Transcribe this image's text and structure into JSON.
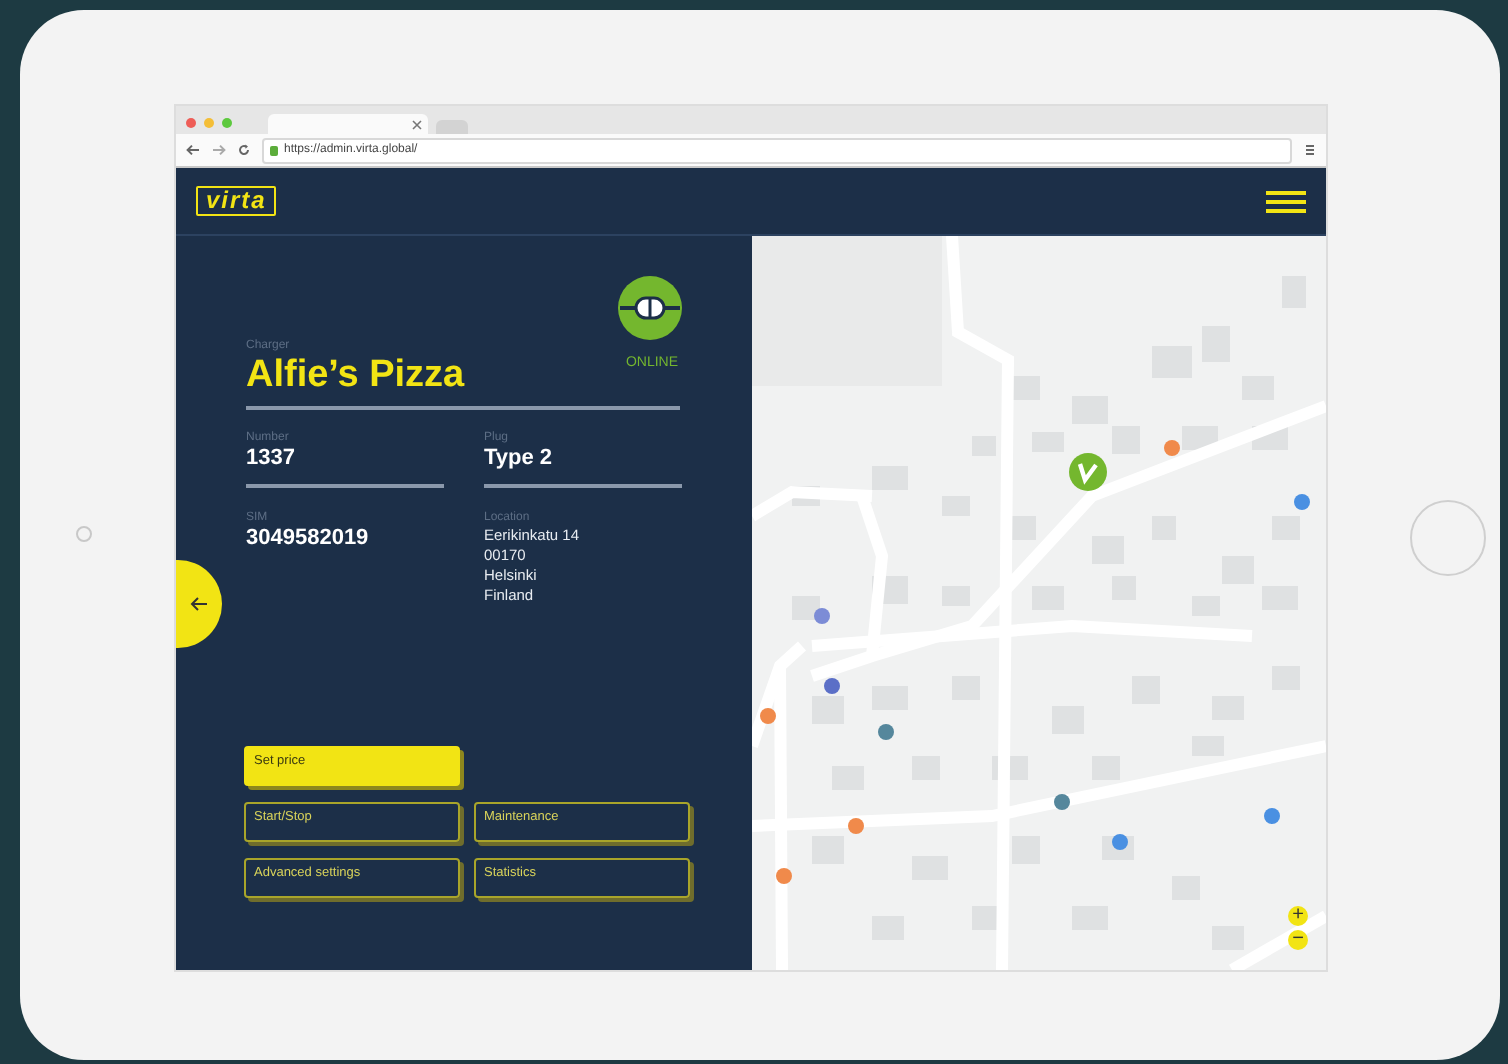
{
  "browser": {
    "url": "https://admin.virta.global/"
  },
  "header": {
    "logo": "virta"
  },
  "status": {
    "label": "ONLINE",
    "online": true
  },
  "charger": {
    "label": "Charger",
    "name": "Alfie’s Pizza"
  },
  "fields": [
    {
      "label": "Number",
      "value": [
        "1337"
      ],
      "underline": true
    },
    {
      "label": "Plug",
      "value": [
        "Type 2"
      ],
      "underline": true
    },
    {
      "label": "SIM",
      "value": [
        "3049582019"
      ],
      "underline": false
    },
    {
      "label": "Location",
      "value": [
        "Eerikinkatu 14",
        "00170",
        "Helsinki",
        "Finland"
      ],
      "underline": false
    }
  ],
  "actions": [
    {
      "label": "Set price",
      "selected": true
    },
    {
      "label": "Start/Stop",
      "selected": false
    },
    {
      "label": "Maintenance",
      "selected": false
    },
    {
      "label": "Advanced settings",
      "selected": false
    },
    {
      "label": "Statistics",
      "selected": false
    }
  ],
  "map": {
    "zoom": [
      "+",
      "−"
    ]
  }
}
